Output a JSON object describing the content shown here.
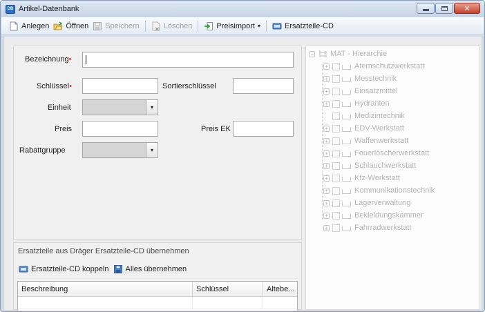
{
  "window": {
    "title": "Artikel-Datenbank",
    "close_glyph": "✕"
  },
  "toolbar": {
    "new_label": "Anlegen",
    "open_label": "Öffnen",
    "save_label": "Speichern",
    "delete_label": "Löschen",
    "price_import_label": "Preisimport",
    "price_import_caret": "▾",
    "spare_parts_cd_label": "Ersatzteile-CD"
  },
  "form": {
    "designation_label": "Bezeichnung",
    "required_mark": "•",
    "key_label": "Schlüssel",
    "sort_key_label": "Sortierschlüssel",
    "unit_label": "Einheit",
    "price_label": "Preis",
    "price_ek_label": "Preis EK",
    "discount_group_label": "Rabattgruppe",
    "dropdown_caret": "▾"
  },
  "spare_parts": {
    "title": "Ersatzteile aus Dräger Ersatzteile-CD übernehmen",
    "couple_label": "Ersatzteile-CD koppeln",
    "take_all_label": "Alles übernehmen",
    "columns": [
      "Beschreibung",
      "Schlüssel",
      "Altebe..."
    ]
  },
  "tree": {
    "root": "MAT - Hierarchie",
    "expand_glyph": "+",
    "collapse_glyph": "−",
    "items": [
      "Atemschutzwerkstatt",
      "Messtechnik",
      "Einsatzmittel",
      "Hydranten",
      "Medizintechnik",
      "EDV-Werkstatt",
      "Waffenwerkstatt",
      "Feuerlöscherwerkstatt",
      "Schlauchwerkstatt",
      "Kfz-Werkstatt",
      "Kommunikationstechnik",
      "Lagerverwaltung",
      "Bekleidungskammer",
      "Fahrradwerkstatt"
    ]
  },
  "colors": {
    "accent": "#2c6fc4",
    "required": "#e03030",
    "disabled_text": "#a2a2a2"
  }
}
